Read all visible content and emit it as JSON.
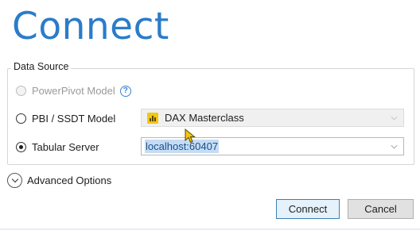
{
  "title": "Connect",
  "data_source": {
    "legend": "Data Source",
    "options": [
      {
        "label": "PowerPivot Model",
        "enabled": false,
        "selected": false,
        "help": "?"
      },
      {
        "label": "PBI / SSDT Model",
        "enabled": true,
        "selected": false
      },
      {
        "label": "Tabular Server",
        "enabled": true,
        "selected": true
      }
    ],
    "model_dropdown": {
      "value": "DAX Masterclass",
      "icon": "power-bi-icon"
    },
    "server_combo": {
      "value": "localhost:60407"
    }
  },
  "advanced_options_label": "Advanced Options",
  "buttons": {
    "connect": "Connect",
    "cancel": "Cancel"
  },
  "colors": {
    "title": "#2b7cc9",
    "selection": "#c5dcf5",
    "help": "#3a83cf"
  }
}
